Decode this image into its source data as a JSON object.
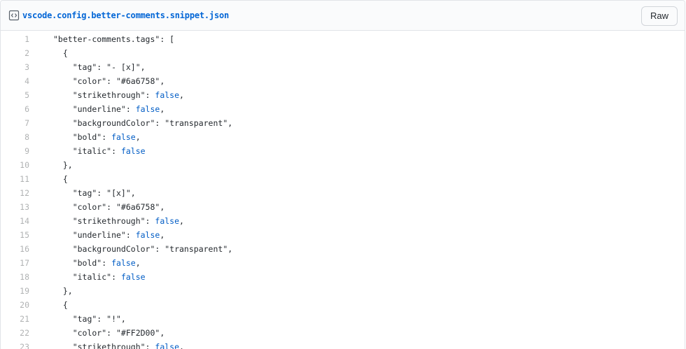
{
  "file": {
    "name": "vscode.config.better-comments.snippet.json",
    "icon": "code-file-icon",
    "raw_label": "Raw"
  },
  "colors": {
    "link": "#0366d6",
    "keyword": "#005cc5",
    "text": "#24292e"
  },
  "code_lines": [
    {
      "n": "1",
      "indent": "",
      "text": "\"better-comments.tags\": [",
      "kw": ""
    },
    {
      "n": "2",
      "indent": "  ",
      "text": "{",
      "kw": ""
    },
    {
      "n": "3",
      "indent": "    ",
      "text": "\"tag\": \"- [x]\",",
      "kw": ""
    },
    {
      "n": "4",
      "indent": "    ",
      "text": "\"color\": \"#6a6758\",",
      "kw": ""
    },
    {
      "n": "5",
      "indent": "    ",
      "text": "\"strikethrough\": ",
      "kw": "false",
      "after": ","
    },
    {
      "n": "6",
      "indent": "    ",
      "text": "\"underline\": ",
      "kw": "false",
      "after": ","
    },
    {
      "n": "7",
      "indent": "    ",
      "text": "\"backgroundColor\": \"transparent\",",
      "kw": ""
    },
    {
      "n": "8",
      "indent": "    ",
      "text": "\"bold\": ",
      "kw": "false",
      "after": ","
    },
    {
      "n": "9",
      "indent": "    ",
      "text": "\"italic\": ",
      "kw": "false",
      "after": ""
    },
    {
      "n": "10",
      "indent": "  ",
      "text": "},",
      "kw": ""
    },
    {
      "n": "11",
      "indent": "  ",
      "text": "{",
      "kw": ""
    },
    {
      "n": "12",
      "indent": "    ",
      "text": "\"tag\": \"[x]\",",
      "kw": ""
    },
    {
      "n": "13",
      "indent": "    ",
      "text": "\"color\": \"#6a6758\",",
      "kw": ""
    },
    {
      "n": "14",
      "indent": "    ",
      "text": "\"strikethrough\": ",
      "kw": "false",
      "after": ","
    },
    {
      "n": "15",
      "indent": "    ",
      "text": "\"underline\": ",
      "kw": "false",
      "after": ","
    },
    {
      "n": "16",
      "indent": "    ",
      "text": "\"backgroundColor\": \"transparent\",",
      "kw": ""
    },
    {
      "n": "17",
      "indent": "    ",
      "text": "\"bold\": ",
      "kw": "false",
      "after": ","
    },
    {
      "n": "18",
      "indent": "    ",
      "text": "\"italic\": ",
      "kw": "false",
      "after": ""
    },
    {
      "n": "19",
      "indent": "  ",
      "text": "},",
      "kw": ""
    },
    {
      "n": "20",
      "indent": "  ",
      "text": "{",
      "kw": ""
    },
    {
      "n": "21",
      "indent": "    ",
      "text": "\"tag\": \"!\",",
      "kw": ""
    },
    {
      "n": "22",
      "indent": "    ",
      "text": "\"color\": \"#FF2D00\",",
      "kw": ""
    },
    {
      "n": "23",
      "indent": "    ",
      "text": "\"strikethrough\": ",
      "kw": "false",
      "after": ","
    }
  ]
}
